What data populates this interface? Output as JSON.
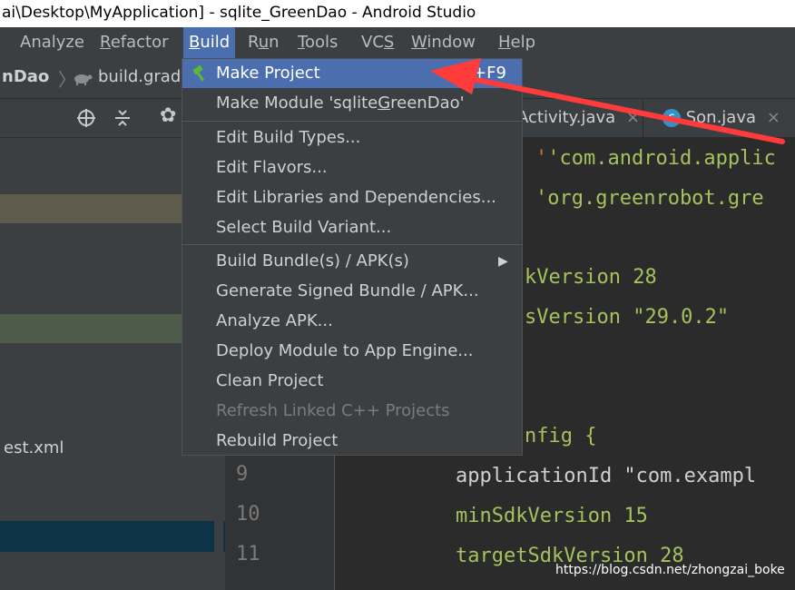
{
  "window": {
    "title": "ai\\Desktop\\MyApplication] - sqlite_GreenDao - Android Studio"
  },
  "menubar": {
    "items": [
      {
        "pre": "",
        "mn": "",
        "post": "Analyze"
      },
      {
        "pre": "",
        "mn": "R",
        "post": "efactor"
      },
      {
        "pre": "",
        "mn": "B",
        "post": "uild"
      },
      {
        "pre": "R",
        "mn": "u",
        "post": "n"
      },
      {
        "pre": "",
        "mn": "T",
        "post": "ools"
      },
      {
        "pre": "VC",
        "mn": "S",
        "post": ""
      },
      {
        "pre": "",
        "mn": "W",
        "post": "indow"
      },
      {
        "pre": "",
        "mn": "H",
        "post": "elp"
      }
    ]
  },
  "navbar": {
    "crumb1": "nDao",
    "crumb2": "build.grad"
  },
  "left_panel": {
    "file_label": "est.xml"
  },
  "editor_tabs": [
    {
      "label": "Activity.java",
      "close": "×"
    },
    {
      "label": "Son.java",
      "close": "×",
      "badge": "c"
    }
  ],
  "build_menu": {
    "make_project": {
      "label": "Make Project",
      "shortcut": "Ctrl+F9"
    },
    "make_module": {
      "pre": "Make Module 'sqlite",
      "mn": "G",
      "post": "reenDao'"
    },
    "group2": [
      "Edit Build Types...",
      "Edit Flavors...",
      "Edit Libraries and Dependencies...",
      "Select Build Variant..."
    ],
    "group3": [
      "Build Bundle(s) / APK(s)",
      "Generate Signed Bundle / APK...",
      "Analyze APK...",
      "Deploy Module to App Engine...",
      "Clean Project",
      "Refresh Linked C++ Projects",
      "Rebuild Project"
    ]
  },
  "code_lines": [
    {
      "text": "'com.android.applic",
      "color": "#a5c25c"
    },
    {
      "text": "'org.greenrobot.gre",
      "color": "#a5c25c"
    },
    {
      "text": "kVersion 28",
      "color": "#a5c25c"
    },
    {
      "text": "sVersion \"29.0.2\"",
      "color": "#a5c25c"
    },
    {
      "text": "nfig {",
      "color": "#a5c25c"
    },
    {
      "text": "applicationId \"com.exampl",
      "color": "#d0d0d0"
    },
    {
      "text": "minSdkVersion 15",
      "color": "#a5c25c"
    },
    {
      "text": "targetSdkVersion 28",
      "color": "#a5c25c"
    }
  ],
  "line_numbers": [
    "9",
    "10",
    "11"
  ],
  "watermark": "https://blog.csdn.net/zhongzai_boke",
  "colors": {
    "accent": "#4b6eaf",
    "arrow": "#ff3b3b",
    "menu_bg": "#3c3f41",
    "editor_bg": "#2b2b2b",
    "number": "#6897bb",
    "string": "#a5c25c"
  },
  "icons": [
    "hammer-icon",
    "turtle-icon",
    "crosshair-icon",
    "collapse-icon",
    "gear-icon",
    "submenu-arrow-icon",
    "class-badge-icon"
  ]
}
